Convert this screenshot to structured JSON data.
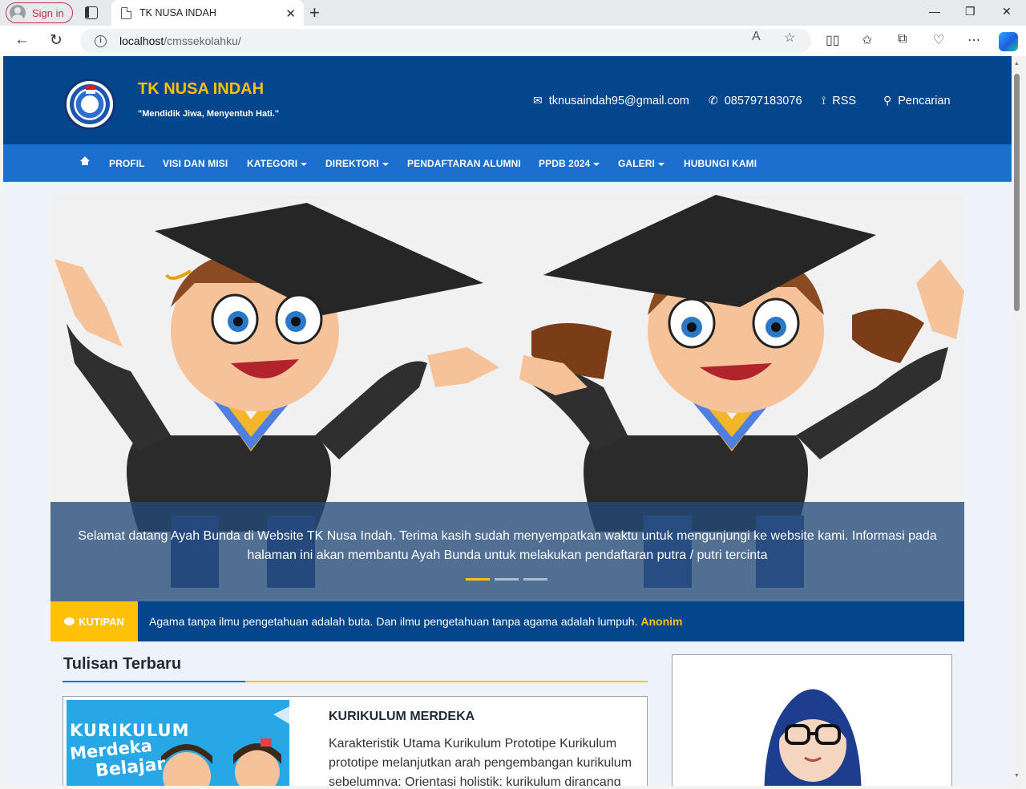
{
  "browser": {
    "sign_in": "Sign in",
    "tab_title": "TK NUSA INDAH",
    "url_host": "localhost",
    "url_path": "/cmssekolahku/"
  },
  "site": {
    "title": "TK NUSA INDAH",
    "tagline": "\"Mendidik Jiwa, Menyentuh Hati.\"",
    "email": "tknusaindah95@gmail.com",
    "phone": "085797183076",
    "rss": "RSS",
    "search": "Pencarian"
  },
  "nav": {
    "items": [
      "PROFIL",
      "VISI DAN MISI",
      "KATEGORI",
      "DIREKTORI",
      "PENDAFTARAN ALUMNI",
      "PPDB 2024",
      "GALERI",
      "HUBUNGI KAMI"
    ]
  },
  "slider": {
    "caption": "Selamat datang Ayah Bunda di Website TK Nusa Indah. Terima kasih sudah menyempatkan waktu untuk mengunjungi ke website kami. Informasi pada halaman ini akan membantu Ayah Bunda untuk melakukan pendaftaran putra / putri tercinta",
    "slide_count": 3,
    "active_slide": 1
  },
  "quote": {
    "label": "KUTIPAN",
    "text": "Agama tanpa ilmu pengetahuan adalah buta. Dan ilmu pengetahuan tanpa agama adalah lumpuh.",
    "author": "Anonim"
  },
  "latest": {
    "heading": "Tulisan Terbaru",
    "post": {
      "image_text": [
        "KURIKULUM",
        "Merdeka",
        "Belajar"
      ],
      "title": "KURIKULUM MERDEKA",
      "excerpt": "Karakteristik Utama Kurikulum Prototipe Kurikulum prototipe melanjutkan arah pengembangan kurikulum sebelumnya; Orientasi holistik: kurikulum dirancang"
    }
  },
  "colors": {
    "header": "#04468c",
    "navbar": "#1a6fcf",
    "accent": "#ffc107"
  }
}
